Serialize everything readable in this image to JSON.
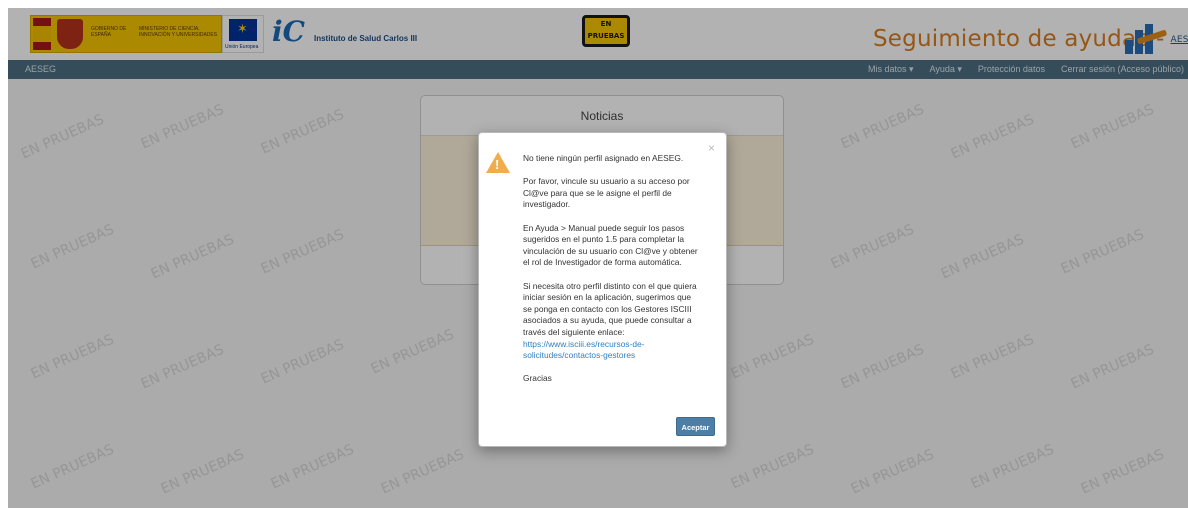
{
  "header": {
    "gobierno_label": "GOBIERNO DE ESPAÑA",
    "ministerio_label": "MINISTERIO DE CIENCIA, INNOVACIÓN Y UNIVERSIDADES",
    "eu_label": "Unión Europea",
    "isciii_label": "Instituto de Salud Carlos III",
    "badge_line1": "EN",
    "badge_line2": "PRUEBAS",
    "app_title": "Seguimiento de ayudas -",
    "app_sub": "AESEG"
  },
  "navbar": {
    "brand": "AESEG",
    "items": [
      {
        "label": "Mis datos ▾"
      },
      {
        "label": "Ayuda ▾"
      },
      {
        "label": "Protección datos"
      },
      {
        "label": "Cerrar sesión (Acceso público)"
      }
    ]
  },
  "watermark_text": "EN PRUEBAS",
  "news_panel": {
    "title": "Noticias"
  },
  "modal": {
    "close": "×",
    "line1": "No tiene ningún perfil asignado en AESEG.",
    "para2": "Por favor, vincule su usuario a su acceso por Cl@ve para que se le asigne el perfil de investigador.",
    "para3": "En Ayuda > Manual puede seguir los pasos sugeridos en el punto 1.5 para completar la vinculación de su usuario con Cl@ve y obtener el rol de Investigador de forma automática.",
    "para4": "Si necesita otro perfil distinto con el que quiera iniciar sesión en la aplicación, sugerimos que se ponga en contacto con los Gestores ISCIII asociados a su ayuda, que puede consultar a través del siguiente enlace:",
    "link": "https://www.isciii.es/recursos-de-solicitudes/contactos-gestores",
    "thanks": "Gracias",
    "button": "Aceptar"
  }
}
